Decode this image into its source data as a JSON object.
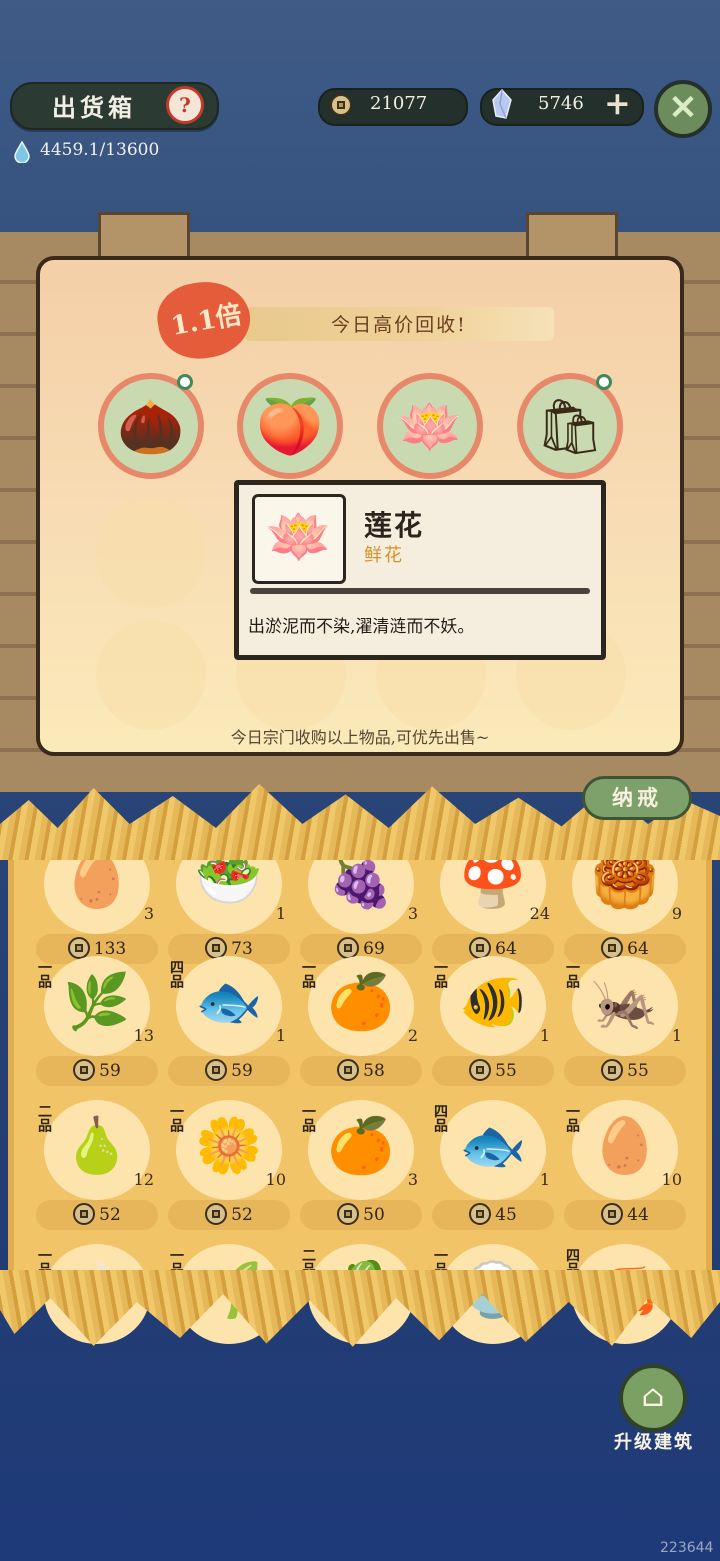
{
  "header": {
    "title": "出货箱",
    "help_icon": "question-mark-icon",
    "water_value": "4459.1/13600",
    "coins": "21077",
    "gems": "5746"
  },
  "bounty": {
    "multiplier": "1.1倍",
    "banner": "今日高价回收!",
    "items": [
      {
        "icon": "buckwheat-seeds-icon",
        "glyph": "🌰"
      },
      {
        "icon": "peach-icon",
        "glyph": "🍑"
      },
      {
        "icon": "lotus-icon",
        "glyph": "🪷"
      },
      {
        "icon": "flour-sack-icon",
        "glyph": "🛍"
      }
    ],
    "hint": "今日宗门收购以上物品,可优先出售~"
  },
  "tooltip": {
    "name": "莲花",
    "category": "鲜花",
    "description": "出淤泥而不染,濯清涟而不妖。",
    "glyph": "🪷"
  },
  "inventory": {
    "tab": "纳戒",
    "rows": [
      [
        {
          "grade": "",
          "qty": "3",
          "price": "133",
          "glyph": "🥚",
          "icon": "egg-icon"
        },
        {
          "grade": "",
          "qty": "1",
          "price": "73",
          "glyph": "🥗",
          "icon": "vegetable-dish-icon"
        },
        {
          "grade": "",
          "qty": "3",
          "price": "69",
          "glyph": "🍇",
          "icon": "grape-icon"
        },
        {
          "grade": "",
          "qty": "24",
          "price": "64",
          "glyph": "🍄",
          "icon": "mushroom-icon"
        },
        {
          "grade": "",
          "qty": "9",
          "price": "64",
          "glyph": "🥮",
          "icon": "cake-icon"
        }
      ],
      [
        {
          "grade": "一品",
          "qty": "13",
          "price": "59",
          "glyph": "🌿",
          "icon": "vine-icon"
        },
        {
          "grade": "四品",
          "qty": "1",
          "price": "59",
          "glyph": "🐟",
          "icon": "fish-icon"
        },
        {
          "grade": "一品",
          "qty": "2",
          "price": "58",
          "glyph": "🍊",
          "icon": "berry-branch-icon"
        },
        {
          "grade": "一品",
          "qty": "1",
          "price": "55",
          "glyph": "🐠",
          "icon": "tropical-fish-icon"
        },
        {
          "grade": "一品",
          "qty": "1",
          "price": "55",
          "glyph": "🦗",
          "icon": "cricket-icon"
        }
      ],
      [
        {
          "grade": "二品",
          "qty": "12",
          "price": "52",
          "glyph": "🍐",
          "icon": "pear-icon"
        },
        {
          "grade": "一品",
          "qty": "10",
          "price": "52",
          "glyph": "🌼",
          "icon": "white-flower-icon"
        },
        {
          "grade": "一品",
          "qty": "3",
          "price": "50",
          "glyph": "🍊",
          "icon": "orange-icon"
        },
        {
          "grade": "四品",
          "qty": "1",
          "price": "45",
          "glyph": "🐟",
          "icon": "red-fish-icon"
        },
        {
          "grade": "一品",
          "qty": "10",
          "price": "44",
          "glyph": "🥚",
          "icon": "eggs-on-leaf-icon"
        }
      ],
      [
        {
          "grade": "一品",
          "qty": "",
          "price": "",
          "glyph": "🍲",
          "icon": "dish-icon"
        },
        {
          "grade": "一品",
          "qty": "",
          "price": "",
          "glyph": "🌱",
          "icon": "grass-icon"
        },
        {
          "grade": "二品",
          "qty": "",
          "price": "",
          "glyph": "🥬",
          "icon": "greens-icon"
        },
        {
          "grade": "一品",
          "qty": "",
          "price": "",
          "glyph": "🍚",
          "icon": "rice-icon"
        },
        {
          "grade": "四品",
          "qty": "",
          "price": "",
          "glyph": "🦐",
          "icon": "shrimp-icon"
        }
      ]
    ]
  },
  "upgrade": {
    "label": "升级建筑"
  },
  "watermark": "223644"
}
